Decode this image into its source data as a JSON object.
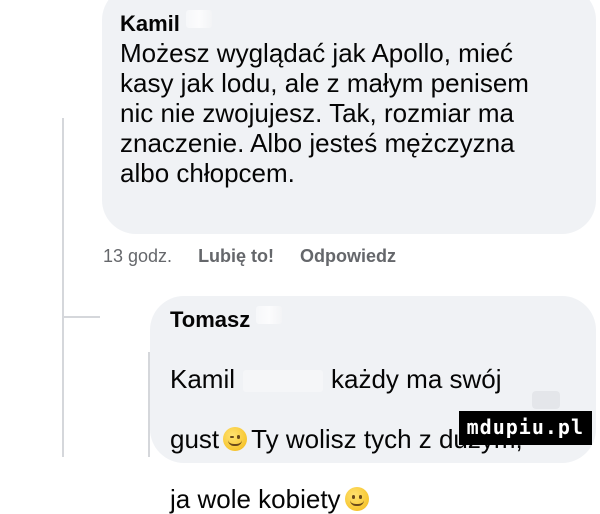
{
  "comment": {
    "author": "Kamil",
    "text": "Możesz wyglądać jak Apollo, mieć\nkasy jak lodu, ale z małym penisem\nnic nie zwojujesz. Tak, rozmiar ma\nznaczenie. Albo jesteś mężczyzna\nalbo chłopcem.",
    "timestamp": "13 godz.",
    "like_label": "Lubię to!",
    "reply_label": "Odpowiedz"
  },
  "reply": {
    "author": "Tomasz",
    "mention": "Kamil",
    "line1_rest": "każdy ma swój",
    "line2_a": "gust",
    "line2_b": "Ty wolisz tych z dużym,",
    "line3": "ja wole kobiety",
    "emoji_1": "winking-face-icon",
    "emoji_2": "smiling-face-icon"
  },
  "watermark": "mdupiu.pl"
}
